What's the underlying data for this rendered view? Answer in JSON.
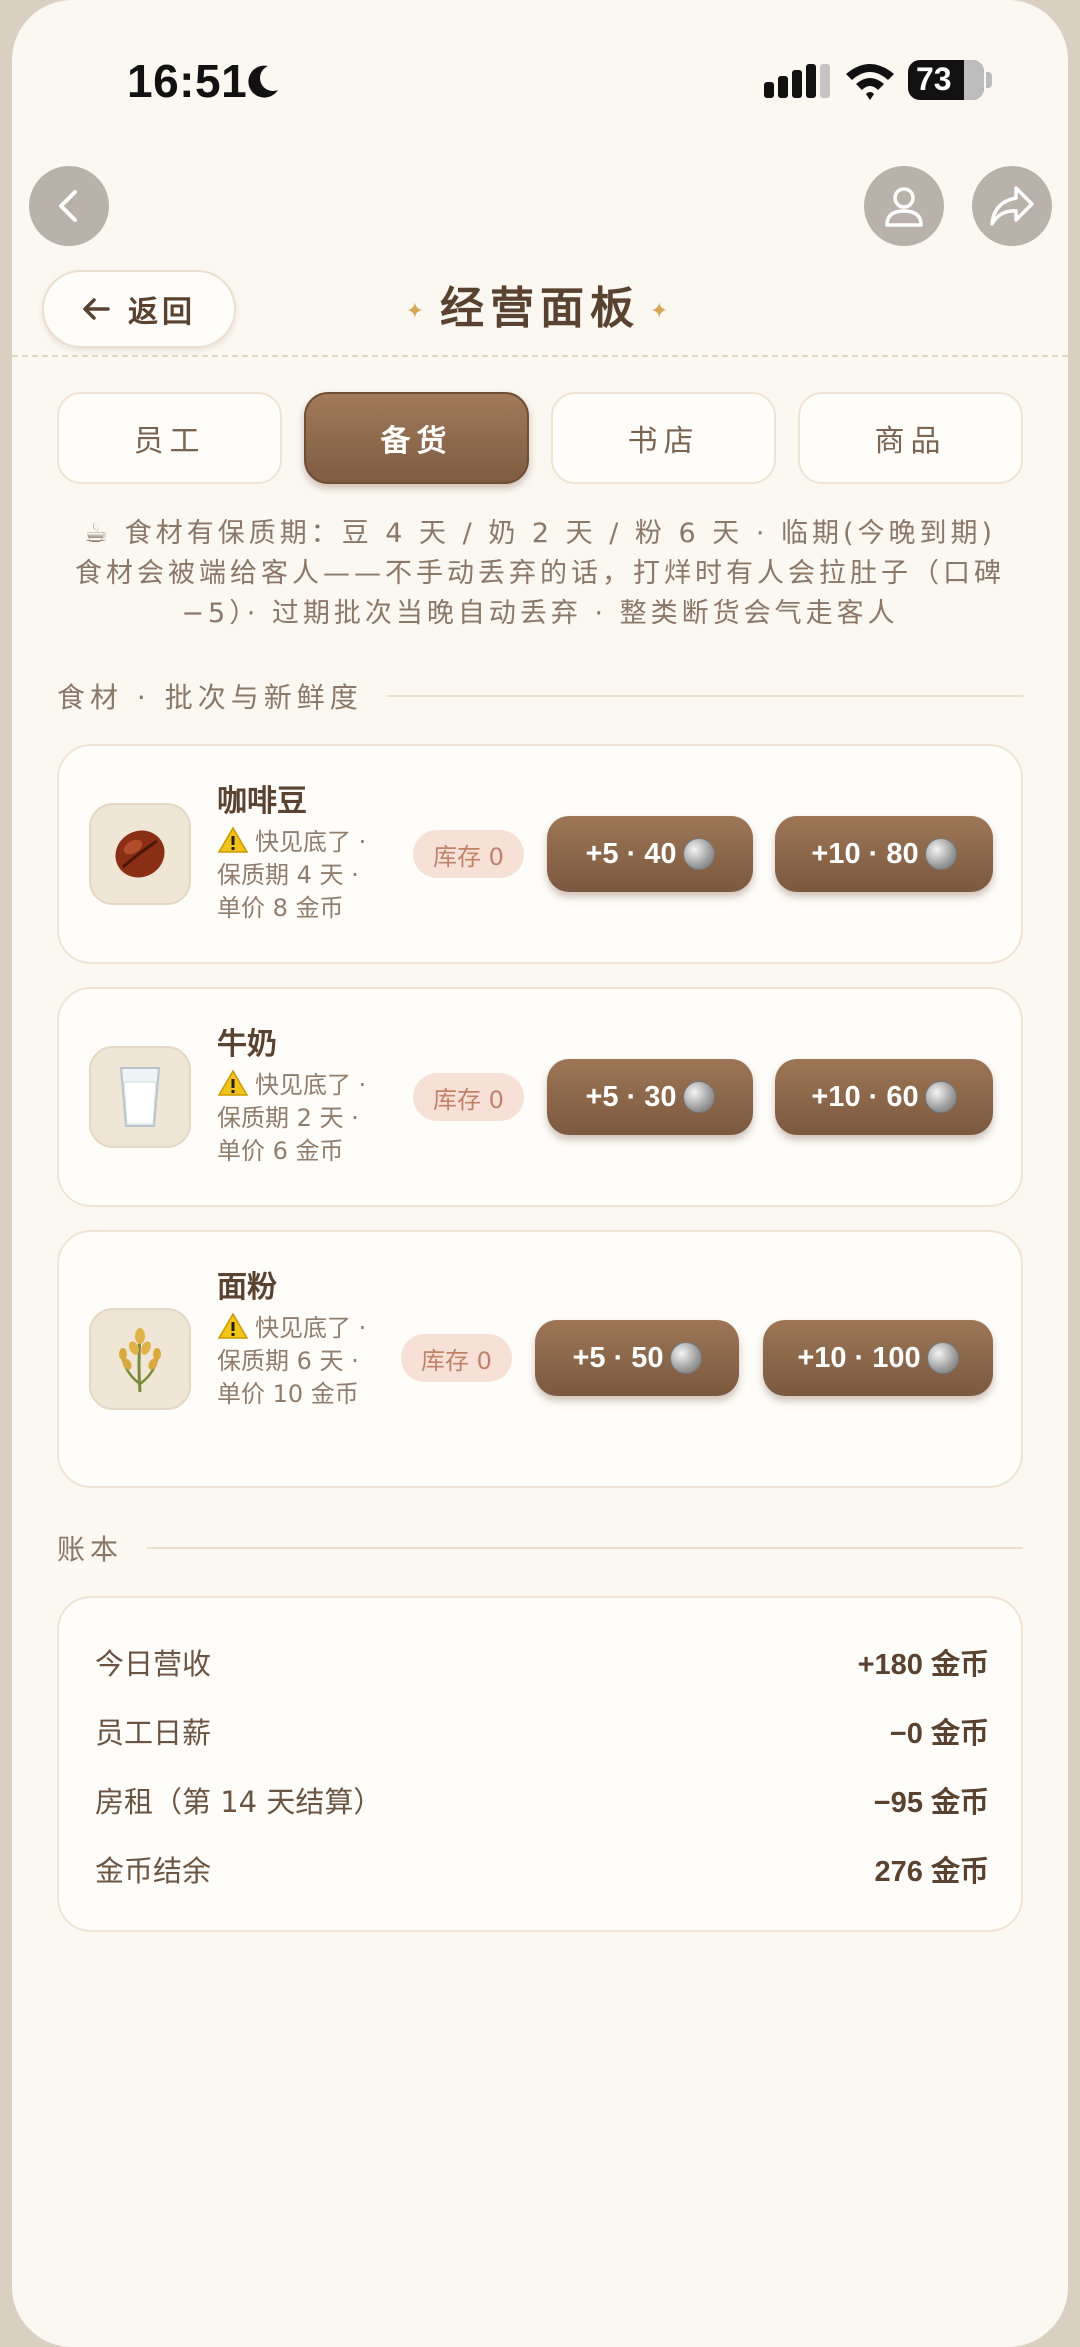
{
  "status_bar": {
    "time": "16:51",
    "battery": "73"
  },
  "header": {
    "back_label": "返回",
    "title": "经营面板"
  },
  "tabs": [
    {
      "label": "员工",
      "active": false
    },
    {
      "label": "备货",
      "active": true
    },
    {
      "label": "书店",
      "active": false
    },
    {
      "label": "商品",
      "active": false
    }
  ],
  "info": {
    "icon": "coffee-icon",
    "text": "食材有保质期：豆 4 天 / 奶 2 天 / 粉 6 天 · 临期(今晚到期)食材会被端给客人——不手动丢弃的话，打烊时有人会拉肚子（口碑 −5）· 过期批次当晚自动丢弃 · 整类断货会气走客人"
  },
  "ingredients_section": {
    "title": "食材 · 批次与新鲜度"
  },
  "items": [
    {
      "name": "咖啡豆",
      "icon": "coffee-bean-icon",
      "desc": "快见底了 · 保质期 4 天 · 单价 8 金币",
      "stock": "库存 0",
      "buy5": "+5 · 40",
      "buy10": "+10 · 80"
    },
    {
      "name": "牛奶",
      "icon": "milk-glass-icon",
      "desc": "快见底了 · 保质期 2 天 · 单价 6 金币",
      "stock": "库存 0",
      "buy5": "+5 · 30",
      "buy10": "+10 · 60"
    },
    {
      "name": "面粉",
      "icon": "wheat-icon",
      "desc": "快见底了 · 保质期 6 天 · 单价 10 金币",
      "stock": "库存 0",
      "buy5": "+5 · 50",
      "buy10": "+10 · 100"
    }
  ],
  "ledger_section": {
    "title": "账本"
  },
  "ledger": [
    {
      "label": "今日营收",
      "value": "+180 金币"
    },
    {
      "label": "员工日薪",
      "value": "−0 金币"
    },
    {
      "label": "房租（第 14 天结算）",
      "value": "−95 金币"
    },
    {
      "label": "金币结余",
      "value": "276 金币"
    }
  ]
}
